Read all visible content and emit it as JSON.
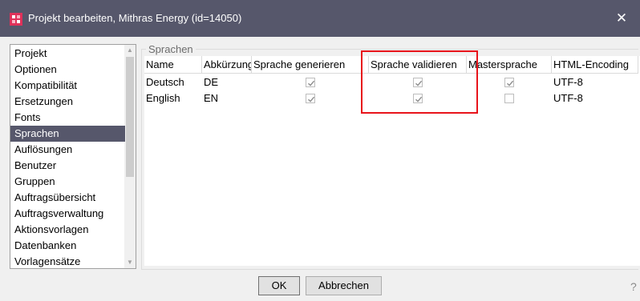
{
  "window": {
    "title": "Projekt bearbeiten, Mithras Energy (id=14050)",
    "close_label": "✕",
    "icon": "app-icon",
    "title_bar_color": "#56576b",
    "icon_color": "#e0315a"
  },
  "sidebar": {
    "items": [
      {
        "label": "Projekt",
        "selected": false
      },
      {
        "label": "Optionen",
        "selected": false
      },
      {
        "label": "Kompatibilität",
        "selected": false
      },
      {
        "label": "Ersetzungen",
        "selected": false
      },
      {
        "label": "Fonts",
        "selected": false
      },
      {
        "label": "Sprachen",
        "selected": true
      },
      {
        "label": "Auflösungen",
        "selected": false
      },
      {
        "label": "Benutzer",
        "selected": false
      },
      {
        "label": "Gruppen",
        "selected": false
      },
      {
        "label": "Auftragsübersicht",
        "selected": false
      },
      {
        "label": "Auftragsverwaltung",
        "selected": false
      },
      {
        "label": "Aktionsvorlagen",
        "selected": false
      },
      {
        "label": "Datenbanken",
        "selected": false
      },
      {
        "label": "Vorlagensätze",
        "selected": false
      }
    ],
    "selected_color": "#56576b"
  },
  "group": {
    "legend": "Sprachen"
  },
  "table": {
    "columns": [
      "Name",
      "Abkürzung",
      "Sprache generieren",
      "Sprache validieren",
      "Mastersprache",
      "HTML-Encoding"
    ],
    "rows": [
      {
        "name": "Deutsch",
        "abbr": "DE",
        "generate": true,
        "validate": true,
        "master": true,
        "encoding": "UTF-8"
      },
      {
        "name": "English",
        "abbr": "EN",
        "generate": true,
        "validate": true,
        "master": false,
        "encoding": "UTF-8"
      }
    ]
  },
  "highlight_color": "#e8141b",
  "buttons": {
    "ok": "OK",
    "cancel": "Abbrechen"
  },
  "help": {
    "label": "?"
  }
}
